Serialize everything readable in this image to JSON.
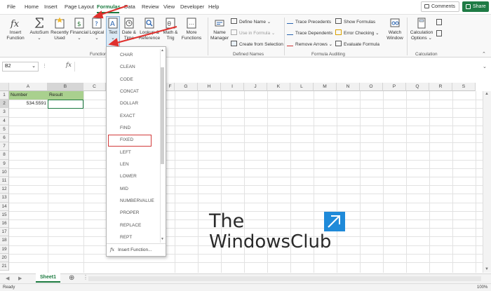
{
  "tabs": [
    "File",
    "Home",
    "Insert",
    "Page Layout",
    "Formulas",
    "Data",
    "Review",
    "View",
    "Developer",
    "Help"
  ],
  "active_tab": "Formulas",
  "top_buttons": {
    "comments": "Comments",
    "share": "Share"
  },
  "ribbon": {
    "insert_function": [
      "Insert",
      "Function"
    ],
    "autosum": "AutoSum",
    "recently_used": [
      "Recently",
      "Used"
    ],
    "financial": "Financial",
    "logical": "Logical",
    "text": "Text",
    "date_time": [
      "Date &",
      "Time"
    ],
    "lookup": [
      "Lookup &",
      "Reference"
    ],
    "math": [
      "Math &",
      "Trig"
    ],
    "more": [
      "More",
      "Functions"
    ],
    "name_manager": [
      "Name",
      "Manager"
    ],
    "define_name": "Define Name",
    "use_in_formula": "Use in Formula",
    "create_from_selection": "Create from Selection",
    "trace_precedents": "Trace Precedents",
    "trace_dependents": "Trace Dependents",
    "remove_arrows": "Remove Arrows",
    "show_formulas": "Show Formulas",
    "error_checking": "Error Checking",
    "evaluate_formula": "Evaluate Formula",
    "watch_window": [
      "Watch",
      "Window"
    ],
    "calc_options": [
      "Calculation",
      "Options"
    ],
    "group_labels": {
      "function": "Function",
      "defined_names": "Defined Names",
      "formula_auditing": "Formula Auditing",
      "calculation": "Calculation"
    }
  },
  "formula_bar": {
    "name_box": "B2",
    "fx": "fx"
  },
  "columns": [
    "A",
    "B",
    "C",
    "F",
    "G",
    "H",
    "I",
    "J",
    "K",
    "L",
    "M",
    "N",
    "O",
    "P",
    "Q",
    "R",
    "S"
  ],
  "rows": [
    "1",
    "2",
    "3",
    "4",
    "5",
    "6",
    "7",
    "8",
    "9",
    "10",
    "11",
    "12",
    "13",
    "14",
    "15",
    "16",
    "17",
    "18",
    "19",
    "20",
    "21"
  ],
  "cells": {
    "a1": "Number",
    "b1": "Result",
    "a2": "534.5591"
  },
  "dropdown": {
    "items": [
      "CHAR",
      "CLEAN",
      "CODE",
      "CONCAT",
      "DOLLAR",
      "EXACT",
      "FIND",
      "FIXED",
      "LEFT",
      "LEN",
      "LOWER",
      "MID",
      "NUMBERVALUE",
      "PROPER",
      "REPLACE",
      "REPT"
    ],
    "insert_function": "Insert Function...",
    "fx": "fx"
  },
  "sheet_tab": "Sheet1",
  "status": {
    "ready": "Ready",
    "zoom": "100%"
  },
  "watermark": {
    "line1": "The",
    "line2": "WindowsClub"
  },
  "colors": {
    "accent": "#1b7a3f",
    "highlight": "#d23b3b",
    "header_fill": "#a9d08e"
  }
}
